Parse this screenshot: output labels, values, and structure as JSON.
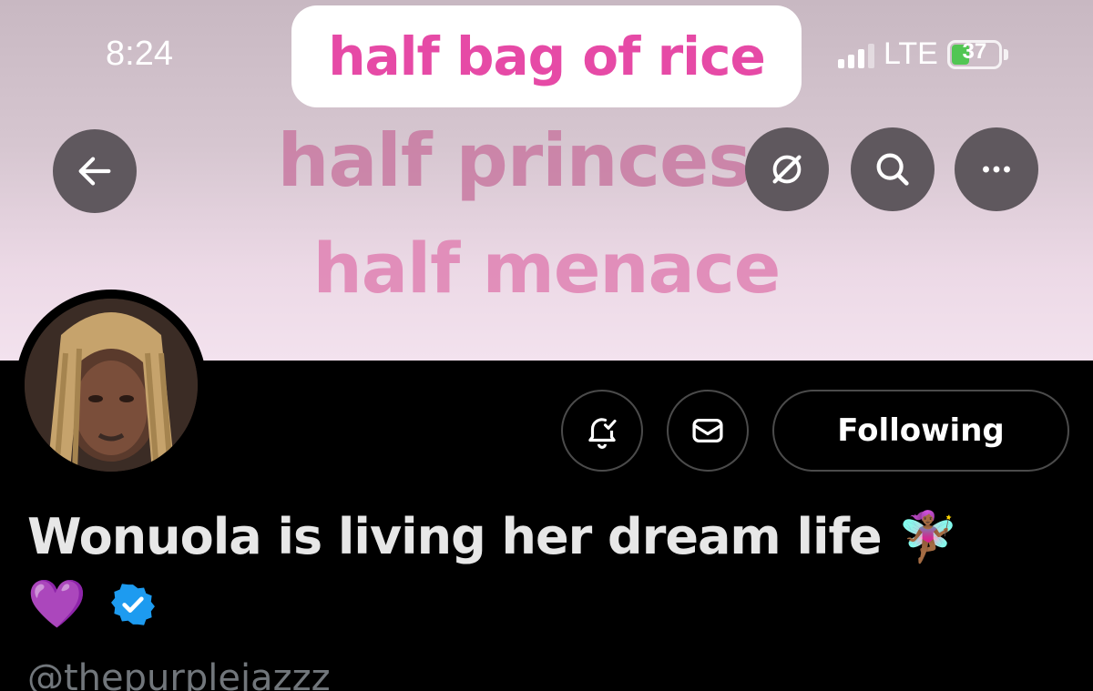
{
  "status_bar": {
    "time": "8:24",
    "network": "LTE",
    "battery": "37"
  },
  "banner": {
    "headline": "half bag of rice",
    "line2": "half princess",
    "line3": "half menace"
  },
  "nav": {
    "back_icon": "arrow-left-icon",
    "grok_icon": "grok-icon",
    "search_icon": "search-icon",
    "more_icon": "more-icon"
  },
  "actions": {
    "following_label": "Following"
  },
  "profile": {
    "display_name": "Wonuola is living her dream life 🧚🏾‍♀️",
    "heart": "💜",
    "handle": "@thepurplejazzz"
  },
  "colors": {
    "accent_pink": "#e64aa6",
    "verified_blue": "#1d9bf0",
    "battery_green": "#52c653"
  }
}
